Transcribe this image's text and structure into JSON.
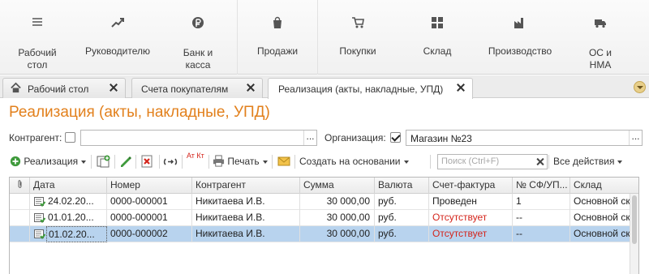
{
  "sections": [
    {
      "id": "desktop",
      "label": "Рабочий\nстол",
      "icon": "menu-lines-icon"
    },
    {
      "id": "manager",
      "label": "Руководителю",
      "icon": "trend-chart-icon"
    },
    {
      "id": "bank",
      "label": "Банк и\nкасса",
      "icon": "ruble-coin-icon"
    },
    {
      "id": "sales",
      "label": "Продажи",
      "icon": "shopping-bag-icon"
    },
    {
      "id": "purchases",
      "label": "Покупки",
      "icon": "shopping-cart-icon"
    },
    {
      "id": "warehouse",
      "label": "Склад",
      "icon": "warehouse-grid-icon"
    },
    {
      "id": "production",
      "label": "Производство",
      "icon": "factory-icon"
    },
    {
      "id": "assets",
      "label": "ОС и\nНМА",
      "icon": "truck-icon"
    }
  ],
  "tabs": [
    {
      "label": "Рабочий стол",
      "icon": "home-icon"
    },
    {
      "label": "Счета покупателям"
    },
    {
      "label": "Реализация (акты, накладные, УПД)"
    }
  ],
  "form": {
    "title": "Реализация (акты, накладные, УПД)",
    "counterparty_label": "Контрагент:",
    "counterparty_value": "",
    "counterparty_checked": false,
    "organization_label": "Организация:",
    "organization_value": "Магазин №23",
    "organization_checked": true,
    "ellipsis": "..."
  },
  "toolbar": {
    "realization_label": "Реализация",
    "print_label": "Печать",
    "create_based_label": "Создать на основании",
    "search_placeholder": "Поиск (Ctrl+F)",
    "all_actions_label": "Все действия",
    "dt_kt_label": "Ат Кт"
  },
  "table": {
    "columns": [
      "Дата",
      "Номер",
      "Контрагент",
      "Сумма",
      "Валюта",
      "Счет-фактура",
      "№ СФ/УП...",
      "Склад"
    ],
    "rows": [
      {
        "date": "24.02.20...",
        "number": "0000-000001",
        "counterparty": "Никитаева И.В.",
        "sum": "30 000,00",
        "currency": "руб.",
        "invoice": "Проведен",
        "sf_number": "1",
        "warehouse": "Основной склад",
        "invoice_missing": false,
        "selected": false
      },
      {
        "date": "01.01.20...",
        "number": "0000-000001",
        "counterparty": "Никитаева И.В.",
        "sum": "30 000,00",
        "currency": "руб.",
        "invoice": "Отсутствует",
        "sf_number": "--",
        "warehouse": "Основной склад",
        "invoice_missing": true,
        "selected": false
      },
      {
        "date": "01.02.20...",
        "number": "0000-000002",
        "counterparty": "Никитаева И.В.",
        "sum": "30 000,00",
        "currency": "руб.",
        "invoice": "Отсутствует",
        "sf_number": "--",
        "warehouse": "Основной склад",
        "invoice_missing": true,
        "selected": true
      }
    ]
  },
  "colors": {
    "accent": "#e2801c",
    "missing": "#d4251c",
    "selection": "#b8d3ee"
  }
}
